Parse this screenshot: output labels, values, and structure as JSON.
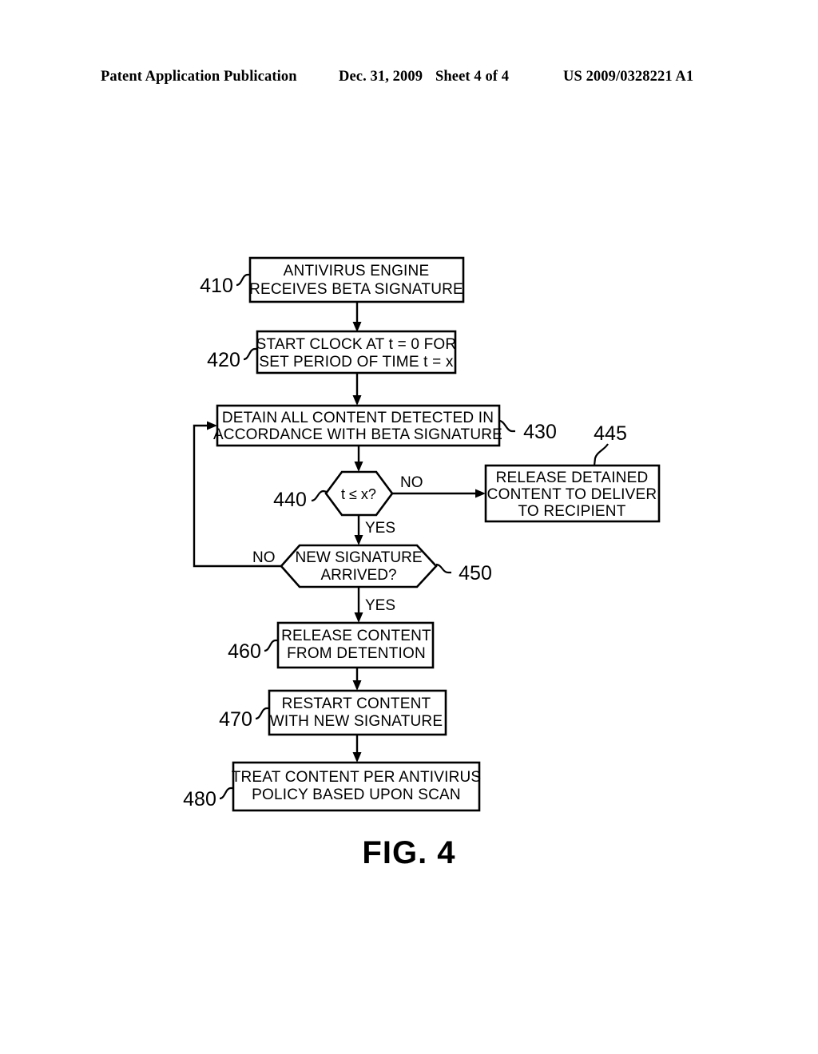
{
  "header": {
    "publication": "Patent Application Publication",
    "date": "Dec. 31, 2009",
    "sheet": "Sheet 4 of 4",
    "patent_number": "US 2009/0328221 A1"
  },
  "figure": {
    "caption": "FIG. 4",
    "nodes": [
      {
        "id": "410",
        "ref": "410",
        "type": "process",
        "lines": [
          "ANTIVIRUS ENGINE",
          "RECEIVES BETA SIGNATURE"
        ]
      },
      {
        "id": "420",
        "ref": "420",
        "type": "process",
        "lines": [
          "START CLOCK AT t = 0 FOR",
          "SET PERIOD OF TIME t = x"
        ]
      },
      {
        "id": "430",
        "ref": "430",
        "type": "process",
        "lines": [
          "DETAIN ALL CONTENT DETECTED IN",
          "ACCORDANCE WITH BETA SIGNATURE"
        ]
      },
      {
        "id": "440",
        "ref": "440",
        "type": "decision",
        "lines": [
          "t ≤ x?"
        ]
      },
      {
        "id": "445",
        "ref": "445",
        "type": "process",
        "lines": [
          "RELEASE DETAINED",
          "CONTENT TO DELIVER",
          "TO RECIPIENT"
        ]
      },
      {
        "id": "450",
        "ref": "450",
        "type": "decision",
        "lines": [
          "NEW SIGNATURE",
          "ARRIVED?"
        ]
      },
      {
        "id": "460",
        "ref": "460",
        "type": "process",
        "lines": [
          "RELEASE CONTENT",
          "FROM DETENTION"
        ]
      },
      {
        "id": "470",
        "ref": "470",
        "type": "process",
        "lines": [
          "RESTART CONTENT",
          "WITH NEW SIGNATURE"
        ]
      },
      {
        "id": "480",
        "ref": "480",
        "type": "process",
        "lines": [
          "TREAT CONTENT PER ANTIVIRUS",
          "POLICY BASED UPON SCAN"
        ]
      }
    ],
    "edge_labels": {
      "decision_440_no": "NO",
      "decision_440_yes": "YES",
      "decision_450_no": "NO",
      "decision_450_yes": "YES"
    }
  },
  "colors": {
    "ink": "#000000",
    "paper": "#ffffff"
  }
}
